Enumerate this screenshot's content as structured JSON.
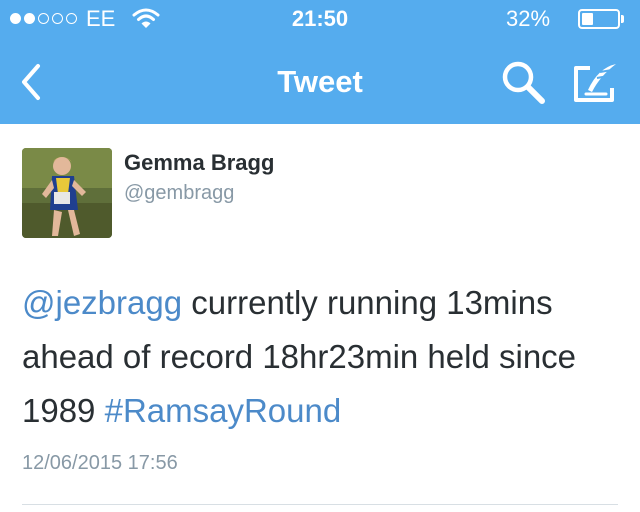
{
  "status_bar": {
    "signal_dots": [
      true,
      true,
      false,
      false,
      false
    ],
    "carrier": "EE",
    "time": "21:50",
    "battery_percent": "32%",
    "battery_level": 0.32
  },
  "nav": {
    "title": "Tweet",
    "back_icon": "chevron-left-icon",
    "search_icon": "search-icon",
    "compose_icon": "compose-icon"
  },
  "tweet": {
    "author_name": "Gemma Bragg",
    "author_handle": "@gembragg",
    "mention": "@jezbragg",
    "text_part1": " currently running 13mins ahead of record 18hr23min held since 1989 ",
    "hashtag": "#RamsayRound",
    "timestamp": "12/06/2015 17:56"
  },
  "colors": {
    "bar": "#55acee",
    "link": "#4c8ac9",
    "muted": "#8899a6"
  }
}
